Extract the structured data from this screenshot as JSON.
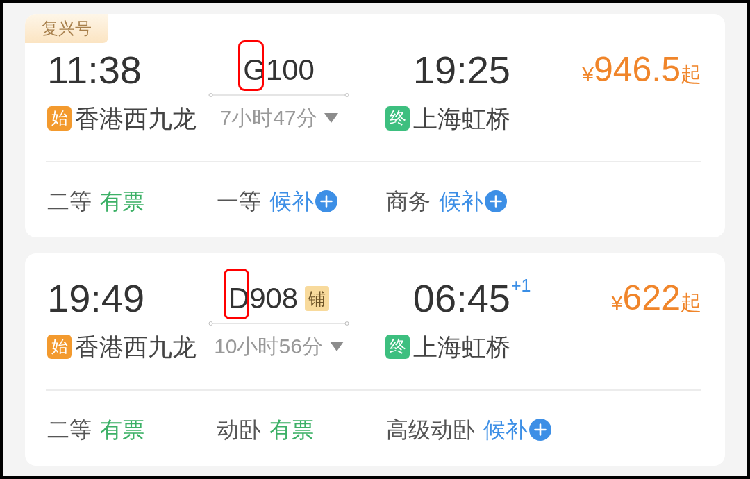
{
  "trains": [
    {
      "tag": "复兴号",
      "departure_time": "11:38",
      "train_number": "G100",
      "number_highlighted": true,
      "arrival_time": "19:25",
      "price": {
        "currency": "¥",
        "amount": "946.5",
        "suffix": "起"
      },
      "origin_badge": "始",
      "departure_station": "香港西九龙",
      "duration": "7小时47分",
      "destination_badge": "终",
      "arrival_station": "上海虹桥",
      "seats": [
        {
          "class": "二等",
          "status": "有票",
          "kind": "available"
        },
        {
          "class": "一等",
          "status": "候补",
          "kind": "waitlist"
        },
        {
          "class": "商务",
          "status": "候补",
          "kind": "waitlist"
        }
      ]
    },
    {
      "departure_time": "19:49",
      "train_number": "D908",
      "number_highlighted": true,
      "berth_badge": "铺",
      "arrival_time": "06:45",
      "day_offset": "+1",
      "price": {
        "currency": "¥",
        "amount": "622",
        "suffix": "起"
      },
      "origin_badge": "始",
      "departure_station": "香港西九龙",
      "duration": "10小时56分",
      "destination_badge": "终",
      "arrival_station": "上海虹桥",
      "seats": [
        {
          "class": "二等",
          "status": "有票",
          "kind": "available"
        },
        {
          "class": "动卧",
          "status": "有票",
          "kind": "available"
        },
        {
          "class": "高级动卧",
          "status": "候补",
          "kind": "waitlist"
        }
      ]
    }
  ]
}
